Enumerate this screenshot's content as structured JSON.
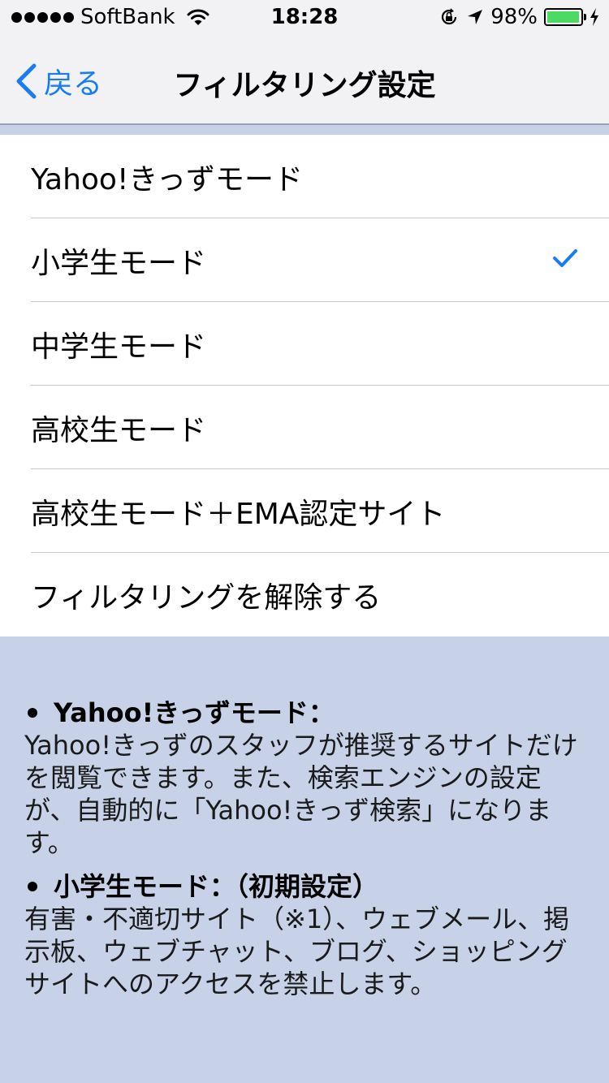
{
  "status_bar": {
    "carrier": "SoftBank",
    "time": "18:28",
    "battery_percent": "98%",
    "battery_level": 0.98
  },
  "nav": {
    "back_label": "戻る",
    "title": "フィルタリング設定"
  },
  "options": [
    {
      "label": "Yahoo!きっずモード",
      "selected": false
    },
    {
      "label": "小学生モード",
      "selected": true
    },
    {
      "label": "中学生モード",
      "selected": false
    },
    {
      "label": "高校生モード",
      "selected": false
    },
    {
      "label": "高校生モード＋EMA認定サイト",
      "selected": false
    },
    {
      "label": "フィルタリングを解除する",
      "selected": false
    }
  ],
  "descriptions": [
    {
      "heading": "Yahoo!きっずモード：",
      "body": "Yahoo!きっずのスタッフが推奨するサイトだけを閲覧できます。また、検索エンジンの設定が、自動的に「Yahoo!きっず検索」になります。"
    },
    {
      "heading": "小学生モード：（初期設定）",
      "body": "有害・不適切サイト（※1）、ウェブメール、掲示板、ウェブチャット、ブログ、ショッピングサイトへのアクセスを禁止します。"
    }
  ],
  "colors": {
    "accent": "#1a7cf5",
    "background": "#c7d2e8",
    "battery_fill": "#4cd964"
  }
}
